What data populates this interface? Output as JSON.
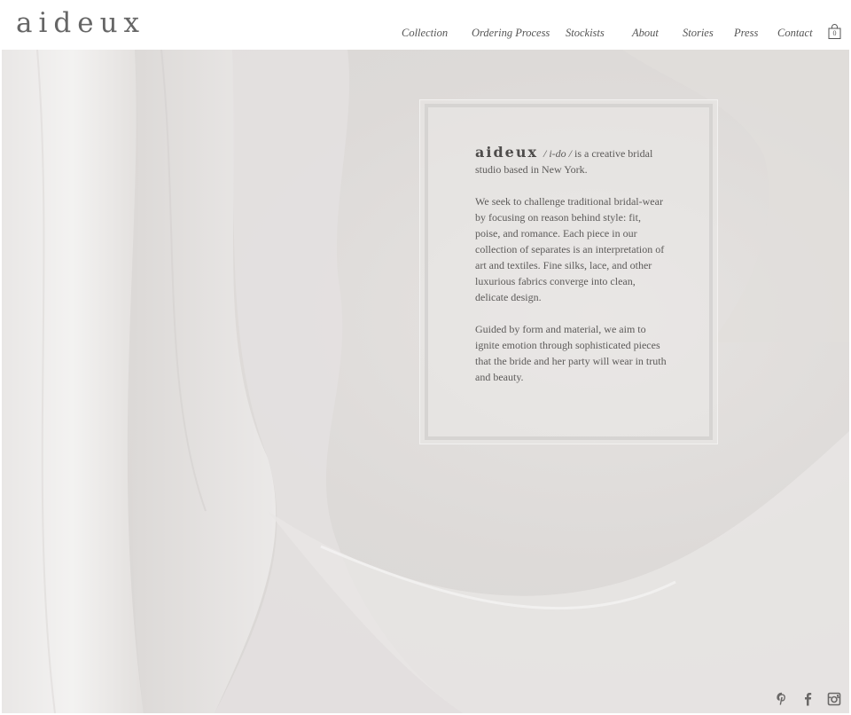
{
  "header": {
    "logo": "aideux",
    "nav": [
      "Collection",
      "Ordering Process",
      "Stockists",
      "About",
      "Stories",
      "Press",
      "Contact"
    ],
    "cart_count": "0"
  },
  "about": {
    "brand": "aideux",
    "pronunciation": "/ i-do /",
    "intro_rest": " is a creative bridal studio based in New York.",
    "paragraph2": "We seek to challenge traditional bridal-wear by focusing on reason behind style: fit, poise, and romance. Each piece in our collection of separates is an interpretation of art and textiles. Fine silks, lace, and other luxurious fabrics converge into clean, delicate design.",
    "paragraph3": "Guided by form and material, we aim to ignite emotion through sophisticated pieces that the bride and her party will wear in truth and beauty."
  },
  "social": {
    "icons": [
      "pinterest-icon",
      "facebook-icon",
      "instagram-icon"
    ]
  },
  "colors": {
    "text": "#555555",
    "hero_bg": "#dedbd9"
  }
}
